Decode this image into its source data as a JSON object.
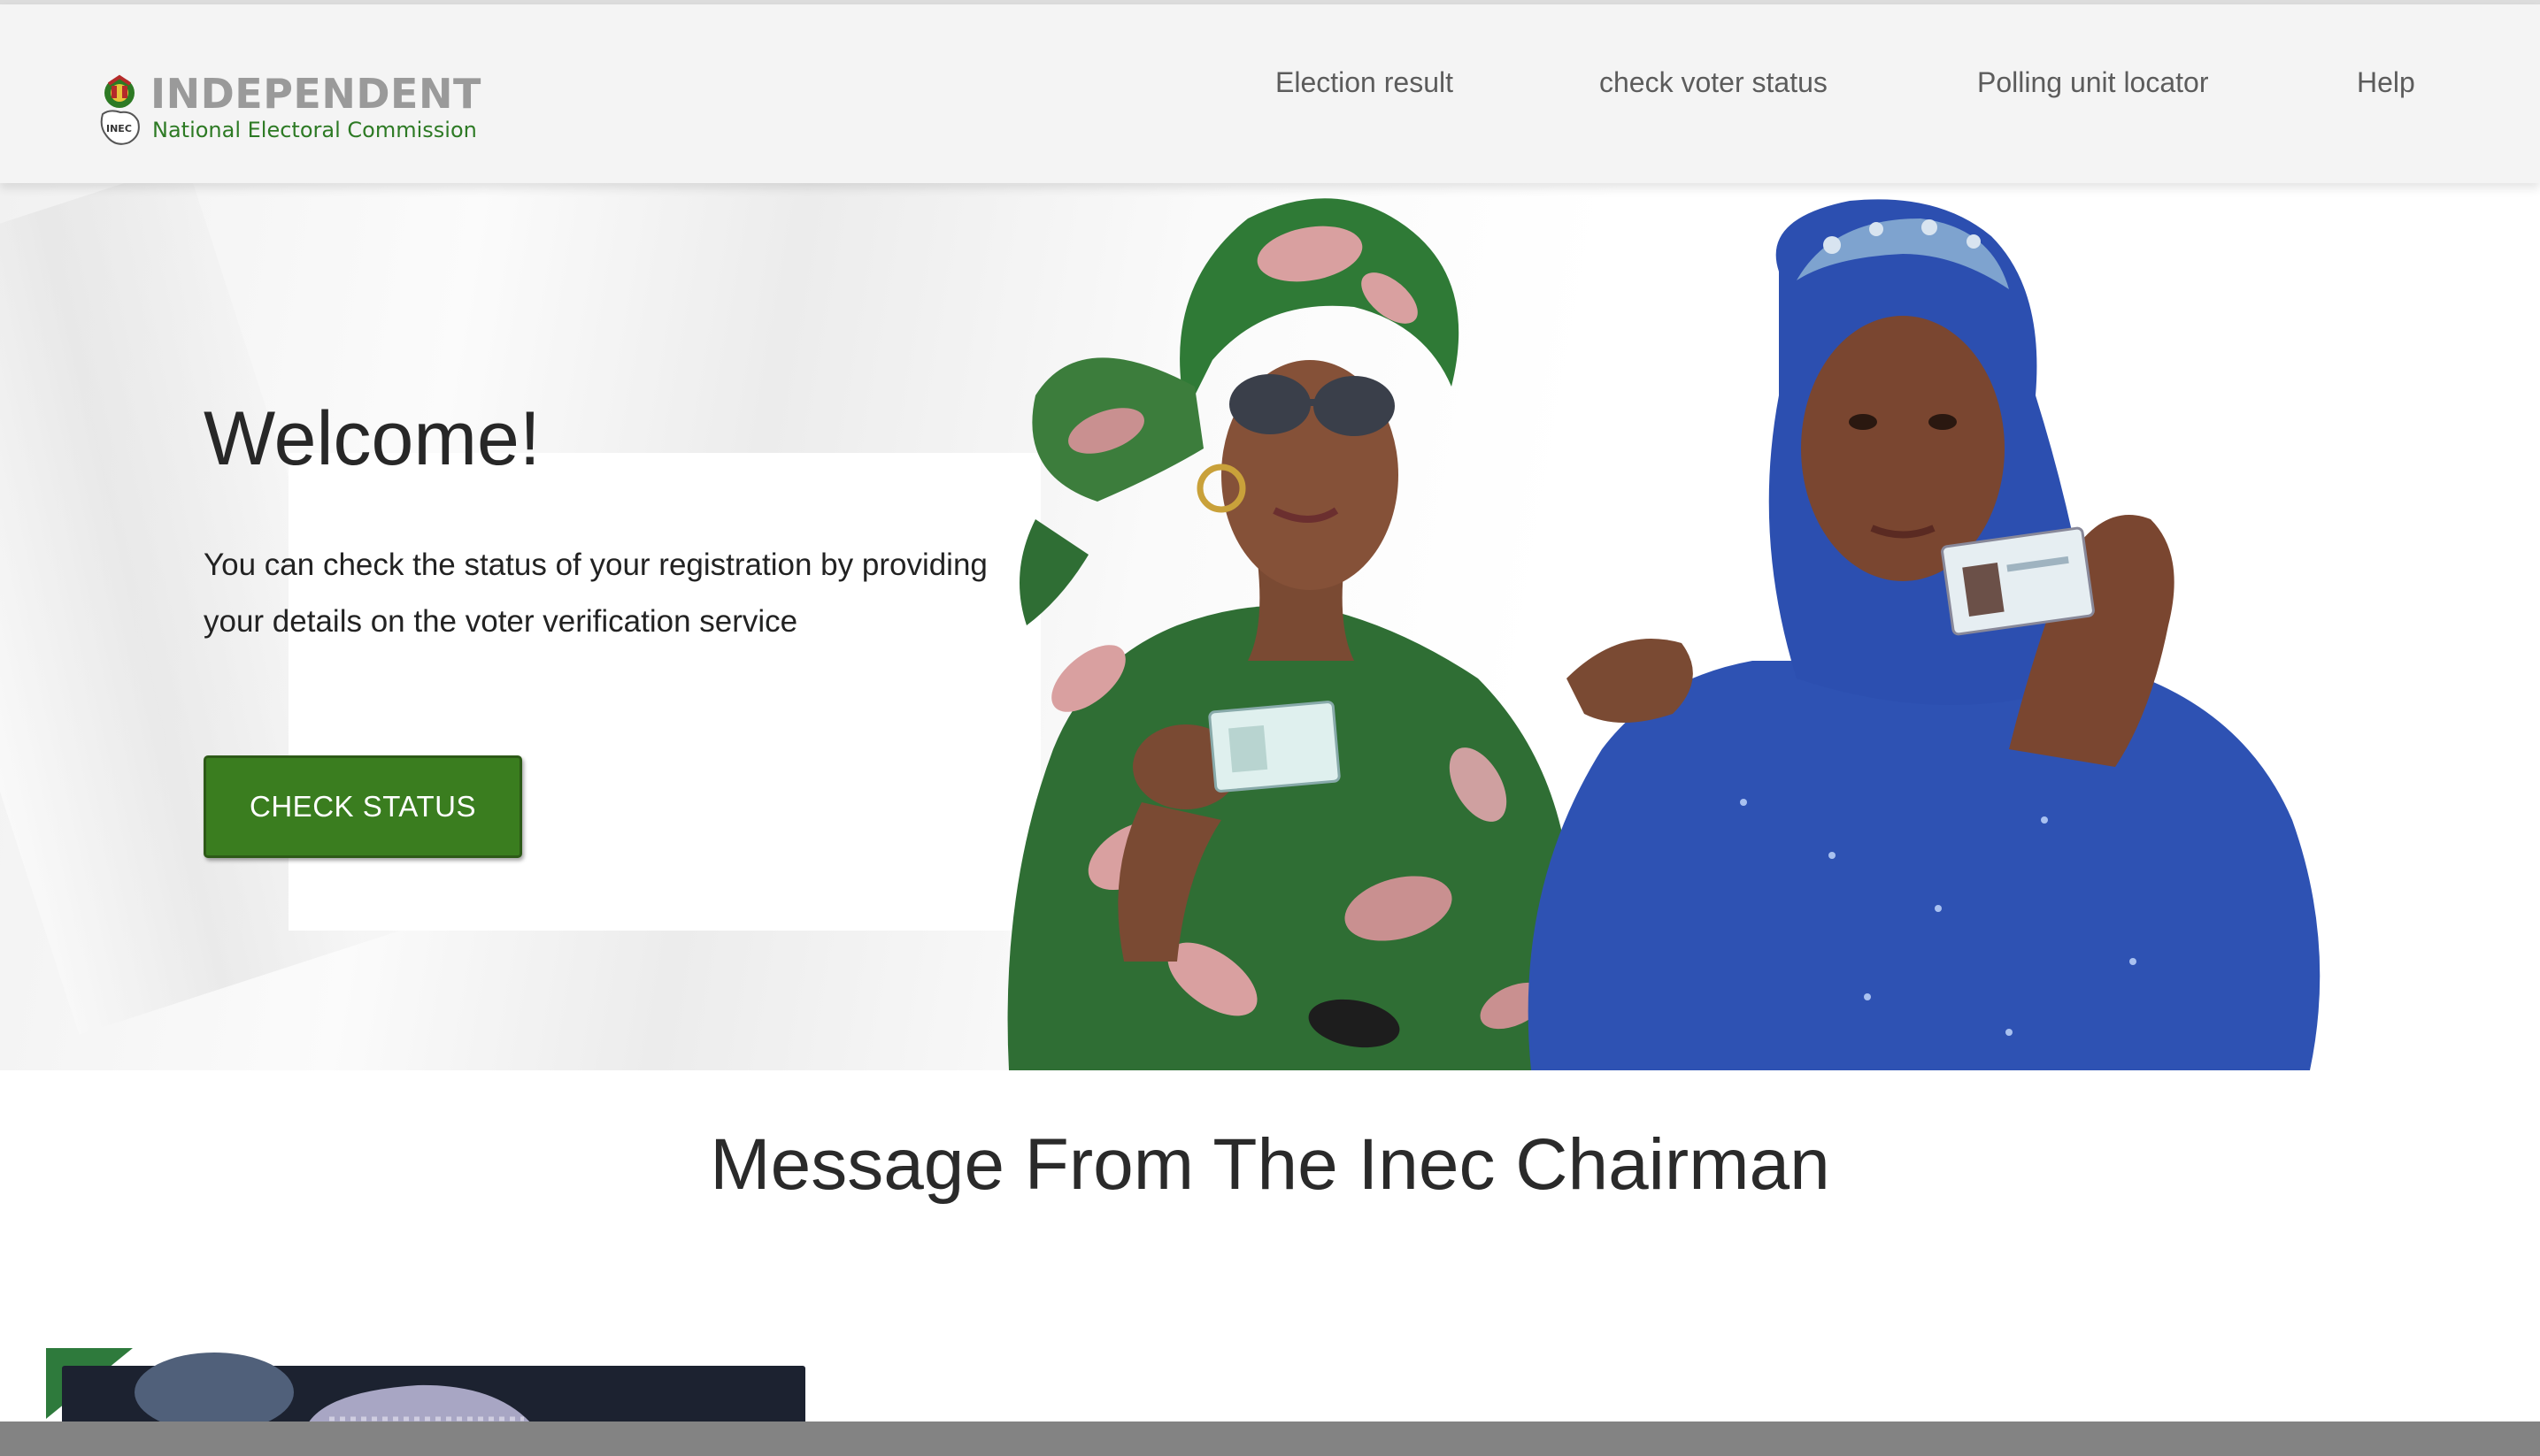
{
  "header": {
    "logo": {
      "title": "INDEPENDENT",
      "subtitle": "National Electoral Commission",
      "emblem_text": "INEC",
      "icon": "inec-emblem-icon"
    },
    "nav": [
      {
        "label": "Election result"
      },
      {
        "label": "check voter status"
      },
      {
        "label": "Polling unit locator"
      },
      {
        "label": "Help"
      }
    ]
  },
  "hero": {
    "heading": "Welcome!",
    "text": "You can check the status of your registration by providing your details on the voter verification service",
    "button_label": "CHECK STATUS",
    "image": "two-women-holding-voter-cards"
  },
  "chairman": {
    "title": "Message From The Inec Chairman",
    "image": "inec-chairman-photo"
  },
  "colors": {
    "brand_green": "#3a7d1f",
    "nav_text": "#5c5c5c",
    "logo_grey": "#9a9a9a",
    "logo_green": "#2d7a24",
    "navbar_bg": "#f4f4f4",
    "footer_bar": "#838383"
  }
}
